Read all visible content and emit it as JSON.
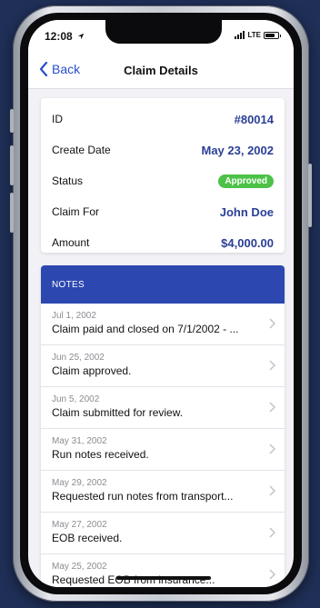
{
  "status_bar": {
    "time": "12:08",
    "network": "LTE"
  },
  "nav": {
    "back_label": "Back",
    "title": "Claim Details"
  },
  "details": [
    {
      "label": "ID",
      "value": "#80014"
    },
    {
      "label": "Create Date",
      "value": "May 23, 2002"
    },
    {
      "label": "Status",
      "value": "Approved"
    },
    {
      "label": "Claim For",
      "value": "John Doe"
    },
    {
      "label": "Amount",
      "value": "$4,000.00"
    }
  ],
  "notes": {
    "header": "NOTES",
    "items": [
      {
        "date": "Jul 1, 2002",
        "text": "Claim paid and closed on 7/1/2002 - ..."
      },
      {
        "date": "Jun 25, 2002",
        "text": "Claim approved."
      },
      {
        "date": "Jun 5, 2002",
        "text": "Claim submitted for review."
      },
      {
        "date": "May 31, 2002",
        "text": "Run notes received."
      },
      {
        "date": "May 29, 2002",
        "text": "Requested run notes from transport..."
      },
      {
        "date": "May 27, 2002",
        "text": "EOB received."
      },
      {
        "date": "May 25, 2002",
        "text": "Requested EOB from insurance..."
      }
    ]
  },
  "colors": {
    "accent": "#2a4fc9",
    "notes_header": "#2c47b0",
    "value_text": "#2a3f96",
    "approved_badge": "#4cc247",
    "background": "#1f2f57"
  },
  "icons": {
    "back": "chevron-left-icon",
    "row": "chevron-right-icon",
    "location": "location-arrow-icon",
    "signal": "signal-bars-icon",
    "battery": "battery-icon"
  }
}
